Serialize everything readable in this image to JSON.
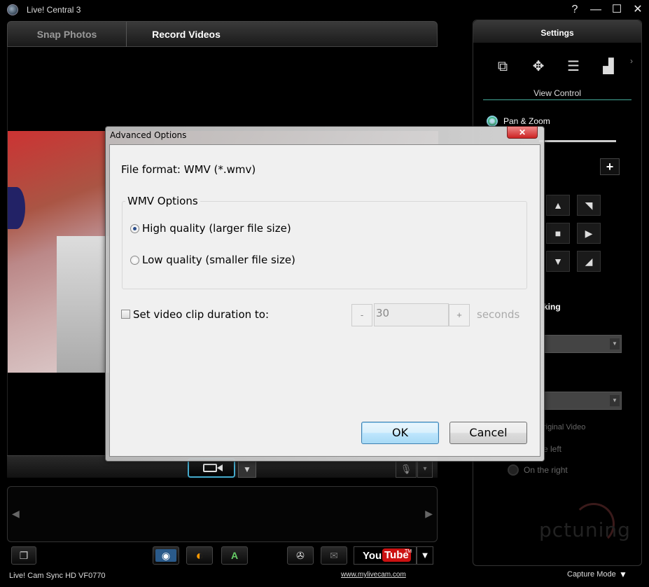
{
  "window": {
    "title": "Live! Central 3",
    "controls": {
      "help": "?",
      "minimize": "—",
      "maximize": "☐",
      "close": "✕"
    }
  },
  "tabs": [
    {
      "label": "Snap Photos",
      "active": false
    },
    {
      "label": "Record Videos",
      "active": true
    }
  ],
  "video_controls": {
    "record_icon": "video-camera-icon",
    "dropdown": "▼",
    "mic_icon": "🎙",
    "mic_dropdown": "▾"
  },
  "filmstrip": {
    "prev": "◀",
    "next": "▶"
  },
  "toolbar": {
    "icons": [
      "windows-icon",
      "camera-icon",
      "orange-circle-icon",
      "image-a-icon",
      "film-reel-icon",
      "mail-icon"
    ],
    "youtube": {
      "you": "You",
      "tube": "Tube",
      "tm": "TM"
    },
    "youtube_dropdown": "▼"
  },
  "status_bar": {
    "device": "Live! Cam Sync HD VF0770",
    "link": "www.mylivecam.com",
    "mode": "Capture Mode",
    "mode_arrow": "▼"
  },
  "settings": {
    "title": "Settings",
    "icons": [
      "display-icon",
      "move-arrows-icon",
      "sliders-icon",
      "brush-icon"
    ],
    "more": "›",
    "section": "View Control",
    "pan_zoom": "Pan & Zoom",
    "zoom_plus": "+",
    "face_tracking": "king",
    "original_video": "riginal Video",
    "on_left": "e left",
    "on_right": "On the right",
    "watermark": "pctuning"
  },
  "dialog": {
    "title": "Advanced Options",
    "close": "✕",
    "file_format": "File format: WMV (*.wmv)",
    "group_label": "WMV Options",
    "options": [
      {
        "label": "High quality (larger file size)",
        "selected": true
      },
      {
        "label": "Low quality (smaller file size)",
        "selected": false
      }
    ],
    "clip_duration_label": "Set video clip duration to:",
    "clip_duration_checked": false,
    "minus": "-",
    "duration_value": "30",
    "plus": "+",
    "unit": "seconds",
    "ok": "OK",
    "cancel": "Cancel"
  },
  "colors": {
    "accent": "#4aaacc",
    "youtube_red": "#cc1111",
    "close_red": "#c22222"
  }
}
